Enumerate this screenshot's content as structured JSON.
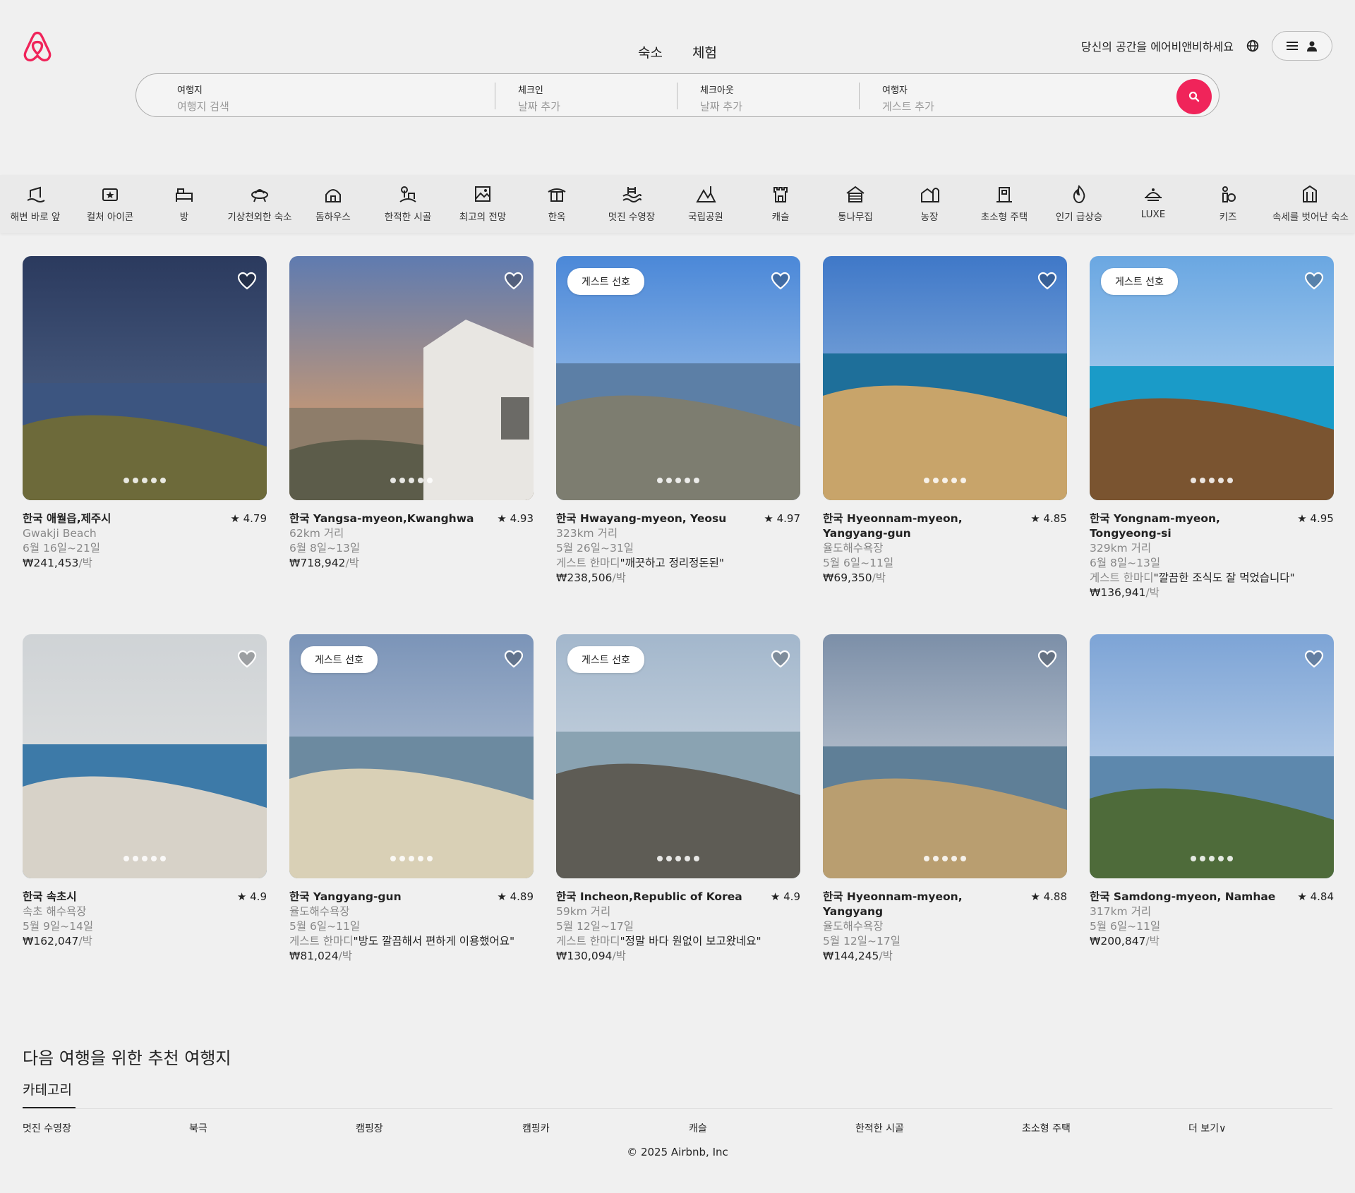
{
  "header": {
    "logo": "airbnb-logo",
    "tabs": [
      "숙소",
      "체험"
    ],
    "host_link": "당신의 공간을 에어비앤비하세요",
    "globe_icon": "globe-icon",
    "menu_icon": "menu-icon",
    "profile_icon": "user-icon"
  },
  "search": {
    "where_label": "여행지",
    "where_placeholder": "여행지 검색",
    "checkin_label": "체크인",
    "checkin_placeholder": "날짜 추가",
    "checkout_label": "체크아웃",
    "checkout_placeholder": "날짜 추가",
    "guests_label": "여행자",
    "guests_placeholder": "게스트 추가",
    "accent_color": "#f0245a"
  },
  "categories": [
    "해변 바로 앞",
    "컬처 아이콘",
    "방",
    "기상천외한 숙소",
    "돔하우스",
    "한적한 시골",
    "최고의 전망",
    "한옥",
    "멋진 수영장",
    "국립공원",
    "캐슬",
    "통나무집",
    "농장",
    "초소형 주택",
    "인기 급상승",
    "LUXE",
    "키즈",
    "속세를 벗어난 숙소"
  ],
  "listings": [
    {
      "badge": "",
      "location": "한국 애월읍,제주시",
      "rating": "★ 4.79",
      "line1": "Gwakji Beach",
      "dates": "6월 16일~21일",
      "review_prefix": "",
      "review_quote": "",
      "price": "₩241,453",
      "per": "/박"
    },
    {
      "badge": "",
      "location": "한국 Yangsa-myeon,Kwanghwa",
      "rating": "★ 4.93",
      "line1": "62km 거리",
      "dates": "6월 8일~13일",
      "review_prefix": "",
      "review_quote": "",
      "price": "₩718,942",
      "per": "/박"
    },
    {
      "badge": "게스트 선호",
      "location": "한국 Hwayang-myeon, Yeosu",
      "rating": "★ 4.97",
      "line1": "323km 거리",
      "dates": "5월 26일~31일",
      "review_prefix": "게스트 한마디",
      "review_quote": "\"깨끗하고 정리정돈된\"",
      "price": "₩238,506",
      "per": "/박"
    },
    {
      "badge": "",
      "location": "한국 Hyeonnam-myeon, Yangyang-gun",
      "rating": "★ 4.85",
      "line1": "율도해수욕장",
      "dates": "5월 6일~11일",
      "review_prefix": "",
      "review_quote": "",
      "price": "₩69,350",
      "per": "/박"
    },
    {
      "badge": "게스트 선호",
      "location": "한국 Yongnam-myeon, Tongyeong-si",
      "rating": "★ 4.95",
      "line1": "329km 거리",
      "dates": "6월 8일~13일",
      "review_prefix": "게스트 한마디",
      "review_quote": "\"깔끔한 조식도 잘 먹었습니다\"",
      "price": "₩136,941",
      "per": "/박"
    },
    {
      "badge": "",
      "location": "한국 속초시",
      "rating": "★ 4.9",
      "line1": "속초 해수욕장",
      "dates": "5월 9일~14일",
      "review_prefix": "",
      "review_quote": "",
      "price": "₩162,047",
      "per": "/박"
    },
    {
      "badge": "게스트 선호",
      "location": "한국 Yangyang-gun",
      "rating": "★ 4.89",
      "line1": "율도해수욕장",
      "dates": "5월 6일~11일",
      "review_prefix": "게스트 한마디",
      "review_quote": "\"방도 깔끔해서 편하게 이용했어요\"",
      "price": "₩81,024",
      "per": "/박"
    },
    {
      "badge": "게스트 선호",
      "location": "한국 Incheon,Republic of Korea",
      "rating": "★ 4.9",
      "line1": "59km 거리",
      "dates": "5월 12일~17일",
      "review_prefix": "게스트 한마디",
      "review_quote": "\"정말 바다 원없이 보고왔네요\"",
      "price": "₩130,094",
      "per": "/박"
    },
    {
      "badge": "",
      "location": "한국 Hyeonnam-myeon, Yangyang",
      "rating": "★ 4.88",
      "line1": "율도해수욕장",
      "dates": "5월 12일~17일",
      "review_prefix": "",
      "review_quote": "",
      "price": "₩144,245",
      "per": "/박"
    },
    {
      "badge": "",
      "location": "한국 Samdong-myeon, Namhae",
      "rating": "★ 4.84",
      "line1": "317km 거리",
      "dates": "5월 6일~11일",
      "review_prefix": "",
      "review_quote": "",
      "price": "₩200,847",
      "per": "/박"
    }
  ],
  "recommendations": {
    "title": "다음 여행을 위한 추천 여행지",
    "tab": "카테고리",
    "items": [
      "멋진 수영장",
      "북극",
      "캠핑장",
      "캠핑카",
      "캐슬",
      "한적한 시골",
      "초소형 주택",
      "더 보기∨"
    ]
  },
  "footer": {
    "copyright": "© 2025 Airbnb, Inc"
  }
}
